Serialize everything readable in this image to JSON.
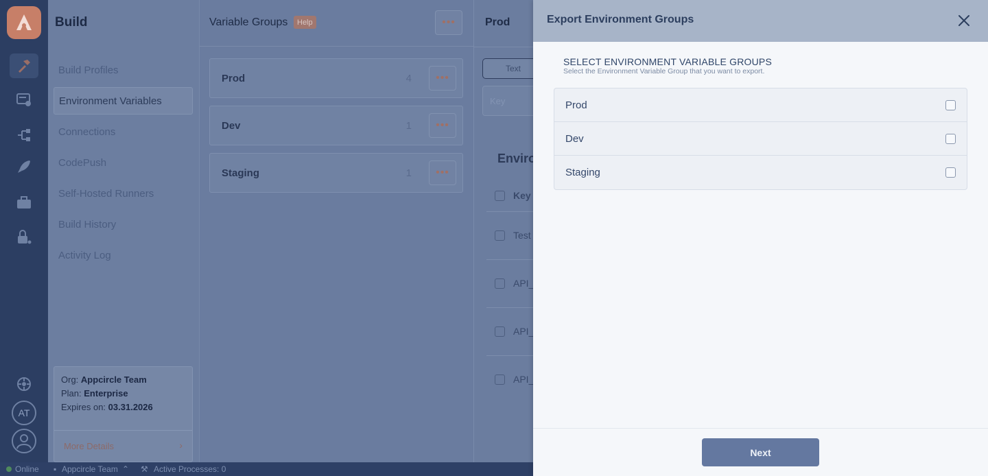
{
  "sidebar_rail": {
    "icons": [
      "appcircle-logo-icon",
      "hammer-icon",
      "certificate-icon",
      "connections-icon",
      "rocket-icon",
      "briefcase-icon",
      "lock-user-icon"
    ],
    "bottom": {
      "settings_icon": "gear-icon",
      "avatar_initials": "AT",
      "user_icon": "user-icon"
    }
  },
  "nav": {
    "title": "Build",
    "items": [
      {
        "label": "Build Profiles"
      },
      {
        "label": "Environment Variables",
        "active": true
      },
      {
        "label": "Connections"
      },
      {
        "label": "CodePush"
      },
      {
        "label": "Self-Hosted Runners"
      },
      {
        "label": "Build History"
      },
      {
        "label": "Activity Log"
      }
    ],
    "org": {
      "org_label": "Org:",
      "org_value": "Appcircle Team",
      "plan_label": "Plan:",
      "plan_value": "Enterprise",
      "expires_label": "Expires on:",
      "expires_value": "03.31.2026",
      "more_details": "More Details"
    }
  },
  "groups": {
    "title": "Variable Groups",
    "help": "Help",
    "items": [
      {
        "name": "Prod",
        "count": "4"
      },
      {
        "name": "Dev",
        "count": "1"
      },
      {
        "name": "Staging",
        "count": "1"
      }
    ]
  },
  "detail": {
    "title": "Prod",
    "tab_text": "Text",
    "key_placeholder": "Key",
    "section_title": "Enviro",
    "header_key": "Key",
    "rows": [
      "Test",
      "API_",
      "API_",
      "API_"
    ]
  },
  "statusbar": {
    "online": "Online",
    "team": "Appcircle Team",
    "processes": "Active Processes: 0"
  },
  "export_panel": {
    "title": "Export Environment Groups",
    "section_title": "SELECT ENVIRONMENT VARIABLE GROUPS",
    "section_subtitle": "Select the Environment Variable Group that you want to export.",
    "options": [
      {
        "label": "Prod",
        "checked": false
      },
      {
        "label": "Dev",
        "checked": false
      },
      {
        "label": "Staging",
        "checked": false
      }
    ],
    "next_label": "Next"
  },
  "colors": {
    "rail": "#2c3e62",
    "accent": "#c77f68",
    "panel_header": "#a7b4c8",
    "next_button": "#6478a0"
  }
}
